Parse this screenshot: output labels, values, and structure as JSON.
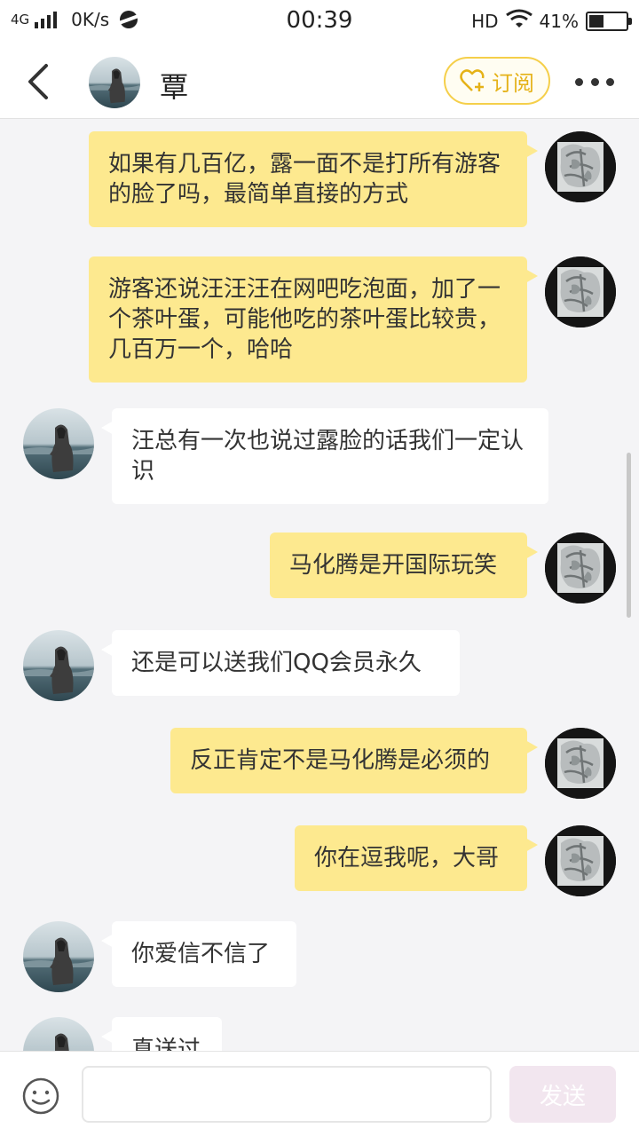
{
  "status_bar": {
    "network": "4G",
    "speed": "0K/s",
    "time": "00:39",
    "hd": "HD",
    "battery": "41%",
    "battery_level": 0.41
  },
  "header": {
    "title": "覃",
    "subscribe_label": "订阅"
  },
  "messages": [
    {
      "from": "me",
      "text": "如果有几百亿，露一面不是打所有游客的脸了吗，最简单直接的方式"
    },
    {
      "from": "me",
      "text": "游客还说汪汪汪在网吧吃泡面，加了一个茶叶蛋，可能他吃的茶叶蛋比较贵，几百万一个，哈哈"
    },
    {
      "from": "them",
      "text": "汪总有一次也说过露脸的话我们一定认识"
    },
    {
      "from": "me",
      "text": "马化腾是开国际玩笑"
    },
    {
      "from": "them",
      "text": "还是可以送我们QQ会员永久"
    },
    {
      "from": "me",
      "text": "反正肯定不是马化腾是必须的"
    },
    {
      "from": "me",
      "text": "你在逗我呢，大哥"
    },
    {
      "from": "them",
      "text": "你爱信不信了"
    },
    {
      "from": "them",
      "text": "真送过"
    }
  ],
  "input_bar": {
    "placeholder": "",
    "send_label": "发送"
  },
  "colors": {
    "accent": "#f5cf4a",
    "my_bubble": "#fde98f",
    "their_bubble": "#ffffff",
    "background": "#f4f4f6"
  },
  "icons": {
    "back": "chevron-left-icon",
    "subscribe": "heart-plus-icon",
    "more": "more-dots-icon",
    "emoji": "smiley-icon",
    "signal": "signal-icon",
    "wifi": "wifi-icon",
    "battery": "battery-icon"
  }
}
